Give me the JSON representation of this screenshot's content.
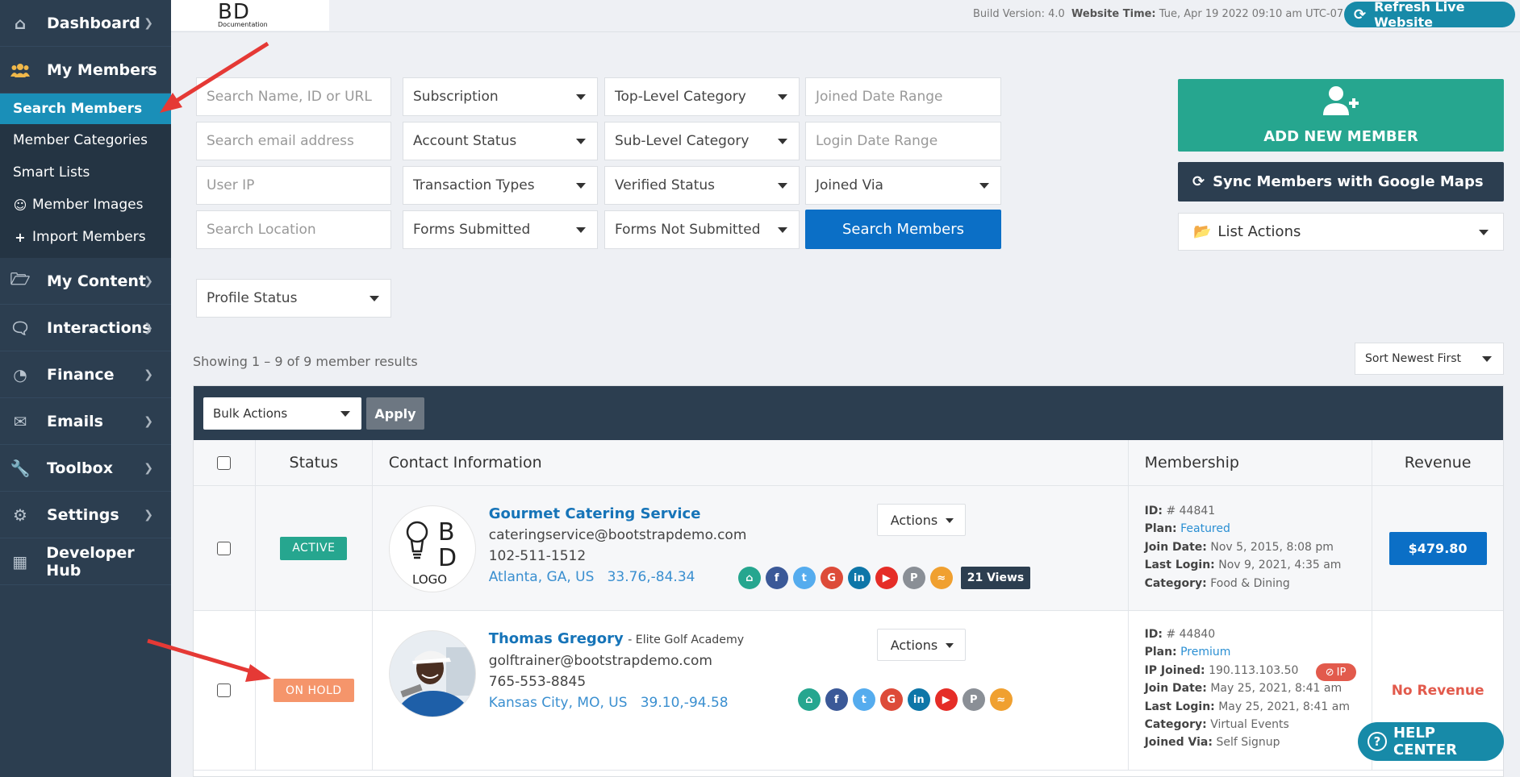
{
  "sidebar": {
    "items": [
      {
        "label": "Dashboard",
        "icon": "dashboard-icon"
      },
      {
        "label": "My Members",
        "icon": "users-icon"
      },
      {
        "label": "My Content",
        "icon": "folder-icon"
      },
      {
        "label": "Interactions",
        "icon": "comments-icon"
      },
      {
        "label": "Finance",
        "icon": "pie-chart-icon"
      },
      {
        "label": "Emails",
        "icon": "inbox-icon"
      },
      {
        "label": "Toolbox",
        "icon": "wrench-icon"
      },
      {
        "label": "Settings",
        "icon": "gear-icon"
      },
      {
        "label": "Developer Hub",
        "icon": "grid-icon"
      }
    ],
    "sub_items": [
      {
        "label": "Search Members"
      },
      {
        "label": "Member Categories"
      },
      {
        "label": "Smart Lists"
      },
      {
        "label": "Member Images",
        "icon": "user-circle-icon"
      },
      {
        "label": "Import Members",
        "icon": "plus-icon"
      }
    ]
  },
  "topbar": {
    "logo_text": "BD",
    "logo_sub": "Documentation",
    "build_version": "Build Version: 4.0",
    "website_time_label": "Website Time:",
    "website_time_value": "Tue, Apr 19 2022 09:10 am UTC-07:00",
    "refresh_label": "Refresh Live Website"
  },
  "filters": {
    "search_name": "Search Name, ID or URL",
    "search_email": "Search email address",
    "user_ip": "User IP",
    "search_location": "Search Location",
    "subscription": "Subscription",
    "account_status": "Account Status",
    "transaction_types": "Transaction Types",
    "forms_submitted": "Forms Submitted",
    "top_level_category": "Top-Level Category",
    "sub_level_category": "Sub-Level Category",
    "verified_status": "Verified Status",
    "forms_not_submitted": "Forms Not Submitted",
    "joined_date_range": "Joined Date Range",
    "login_date_range": "Login Date Range",
    "joined_via": "Joined Via",
    "search_button": "Search Members",
    "profile_status": "Profile Status"
  },
  "right_panel": {
    "add_new_member": "ADD NEW MEMBER",
    "sync_google_maps": "Sync Members with Google Maps",
    "list_actions": "List Actions"
  },
  "results": {
    "showing": "Showing 1 – 9 of 9 member results",
    "sort": "Sort Newest First"
  },
  "table": {
    "bulk_actions": "Bulk Actions",
    "apply": "Apply",
    "headers": {
      "status": "Status",
      "contact": "Contact Information",
      "membership": "Membership",
      "revenue": "Revenue"
    },
    "rows": [
      {
        "status": "ACTIVE",
        "name": "Gourmet Catering Service",
        "company": "",
        "email": "cateringservice@bootstrapdemo.com",
        "phone": "102-511-1512",
        "location": "Atlanta, GA, US",
        "coords": "33.76,-84.34",
        "actions": "Actions",
        "views": "21 Views",
        "logo_top": "B",
        "logo_mid": "D",
        "logo_bottom": "LOGO",
        "id": "# 44841",
        "plan": "Featured",
        "join_date": "Nov 5, 2015, 8:08 pm",
        "last_login": "Nov 9, 2021, 4:35 am",
        "category": "Food & Dining",
        "revenue": "$479.80"
      },
      {
        "status": "ON HOLD",
        "name": "Thomas Gregory",
        "company": "- Elite Golf Academy",
        "email": "golftrainer@bootstrapdemo.com",
        "phone": "765-553-8845",
        "location": "Kansas City, MO, US",
        "coords": "39.10,-94.58",
        "actions": "Actions",
        "id": "# 44840",
        "plan": "Premium",
        "ip_joined": "190.113.103.50",
        "ip_badge": "IP",
        "join_date": "May 25, 2021, 8:41 am",
        "last_login": "May 25, 2021, 8:41 am",
        "category": "Virtual Events",
        "joined_via": "Self Signup",
        "revenue": "No Revenue"
      }
    ],
    "meta_labels": {
      "id": "ID:",
      "plan": "Plan:",
      "ip_joined": "IP Joined:",
      "join_date": "Join Date:",
      "last_login": "Last Login:",
      "category": "Category:",
      "joined_via": "Joined Via:"
    }
  },
  "help_center": "HELP CENTER",
  "colors": {
    "sidebar": "#2c3e50",
    "accent_teal": "#26a68f",
    "accent_blue": "#0b6fc6",
    "on_hold": "#f5956b",
    "annotation_arrow": "#e53935"
  }
}
